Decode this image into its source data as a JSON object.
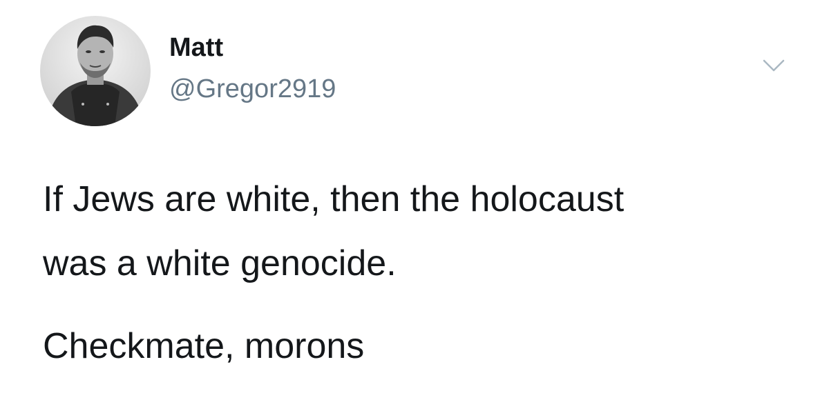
{
  "tweet": {
    "display_name": "Matt",
    "handle": "@Gregor2919",
    "text_lines": [
      "If Jews are white, then the holocaust",
      "was a white genocide.",
      "Checkmate, morons"
    ]
  },
  "icons": {
    "menu": "chevron-down-icon",
    "avatar": "user-photo-avatar"
  },
  "colors": {
    "text": "#14171a",
    "handle": "#657786",
    "chevron": "#aab8c2",
    "background": "#ffffff"
  }
}
